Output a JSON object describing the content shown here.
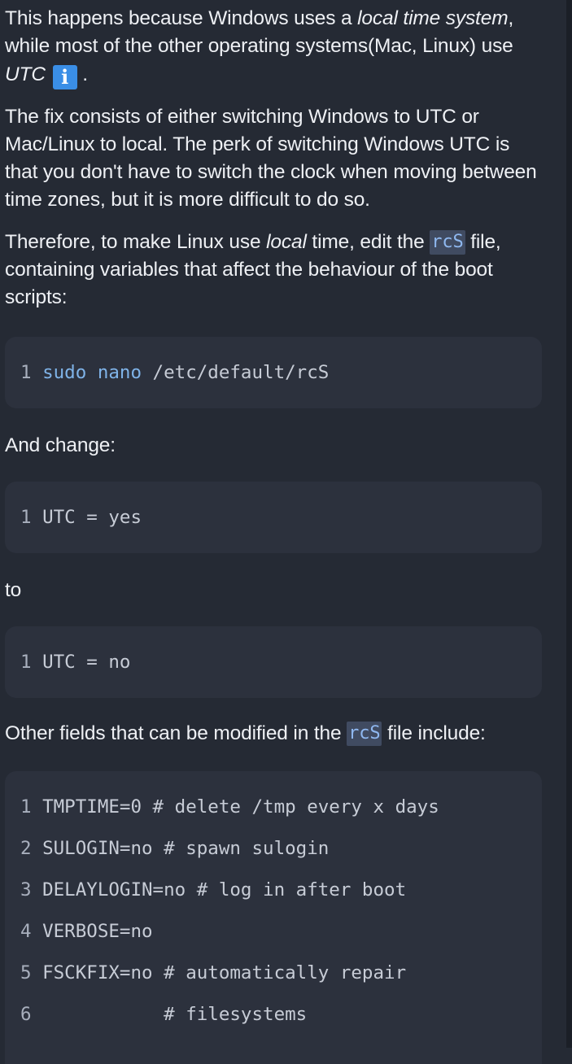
{
  "intro": {
    "part1": "This happens because Windows uses a ",
    "italic1": "local time system",
    "part2": ", while most of the other operating systems(Mac, Linux) use ",
    "italic2": "UTC",
    "info_icon_glyph": "i",
    "part3": " ."
  },
  "fix_paragraph": "The fix consists of either switching Windows to UTC or Mac/Linux to local. The perk of switching Windows UTC is that you don't have to switch the clock when moving between time zones, but it is more difficult to do so.",
  "therefore": {
    "part1": "Therefore, to make Linux use ",
    "italic": "local",
    "part2": " time, edit the ",
    "code": "rcS",
    "part3": " file, containing variables that affect the behaviour of the boot scripts:"
  },
  "code_block_1": {
    "lines": [
      {
        "num": "1",
        "sudo": "sudo",
        "nano": "nano",
        "rest": " /etc/default/rcS"
      }
    ]
  },
  "and_change": "And change:",
  "code_block_2": {
    "lines": [
      {
        "num": "1",
        "text": "UTC = yes"
      }
    ]
  },
  "to_label": "to",
  "code_block_3": {
    "lines": [
      {
        "num": "1",
        "text": "UTC = no"
      }
    ]
  },
  "other_fields": {
    "part1": "Other fields that can be modified in the ",
    "code": "rcS",
    "part2": " file include:"
  },
  "code_block_4": {
    "lines": [
      {
        "num": "1",
        "text": "TMPTIME=0 # delete /tmp every x days"
      },
      {
        "num": "2",
        "text": "SULOGIN=no # spawn sulogin"
      },
      {
        "num": "3",
        "text": "DELAYLOGIN=no # log in after boot"
      },
      {
        "num": "4",
        "text": "VERBOSE=no"
      },
      {
        "num": "5",
        "text": "FSCKFIX=no # automatically repair"
      },
      {
        "num": "6",
        "text": "           # filesystems"
      }
    ]
  },
  "colors": {
    "background": "#252a34",
    "code_background": "#2c313d",
    "inline_code_background": "#404b61",
    "inline_code_text": "#8fb8f0",
    "command_keyword": "#7fb3e8",
    "info_icon": "#3a8ee6"
  },
  "icons": {
    "info": "info-icon"
  }
}
